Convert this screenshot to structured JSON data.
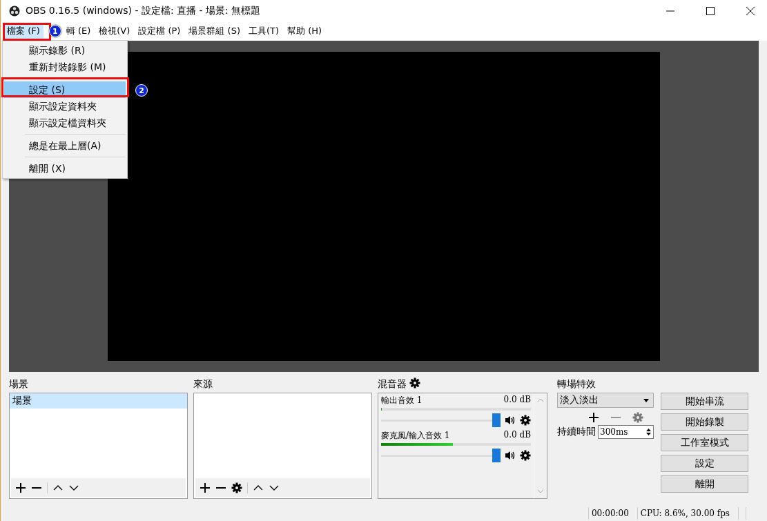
{
  "window": {
    "title": "OBS 0.16.5 (windows) - 設定檔: 直播 - 場景: 無標題"
  },
  "menubar": [
    {
      "label": "檔案 (F)",
      "selected": true
    },
    {
      "label": "輯 (E)",
      "selected": false
    },
    {
      "label": "檢視(V)",
      "selected": false
    },
    {
      "label": "設定檔 (P)",
      "selected": false
    },
    {
      "label": "場景群組 (S)",
      "selected": false
    },
    {
      "label": "工具(T)",
      "selected": false
    },
    {
      "label": "幫助 (H)",
      "selected": false
    }
  ],
  "file_menu": [
    {
      "kind": "item",
      "label": "顯示錄影 (R)",
      "selected": false
    },
    {
      "kind": "item",
      "label": "重新封裝錄影 (M)",
      "selected": false
    },
    {
      "kind": "separator"
    },
    {
      "kind": "item",
      "label": "設定 (S)",
      "selected": true
    },
    {
      "kind": "item",
      "label": "顯示設定資料夾",
      "selected": false
    },
    {
      "kind": "item",
      "label": "顯示設定檔資料夾",
      "selected": false
    },
    {
      "kind": "separator"
    },
    {
      "kind": "item",
      "label": "總是在最上層(A)",
      "selected": false
    },
    {
      "kind": "separator"
    },
    {
      "kind": "item",
      "label": "離開 (X)",
      "selected": false
    }
  ],
  "annotations": [
    "1",
    "2"
  ],
  "scenes": {
    "title": "場景",
    "items": [
      {
        "label": "場景",
        "selected": true
      }
    ]
  },
  "sources": {
    "title": "來源"
  },
  "mixer": {
    "title": "混音器",
    "channels": [
      {
        "name": "輸出音效 1",
        "reading": "0.0 dB",
        "meter": {
          "level": 0
        },
        "level": 1
      },
      {
        "name": "麥克風/輸入音效 1",
        "reading": "0.0 dB",
        "meter": {
          "level": 0.48
        },
        "level": 1
      }
    ]
  },
  "transitions": {
    "title": "轉場特效",
    "effect": "淡入淡出",
    "duration_label": "持續時間",
    "duration": "300ms"
  },
  "controls": [
    "開始串流",
    "開始錄製",
    "工作室模式",
    "設定",
    "離開"
  ],
  "status_bar": [
    "00:00:00",
    "CPU: 8.6%, 30.00 fps"
  ]
}
